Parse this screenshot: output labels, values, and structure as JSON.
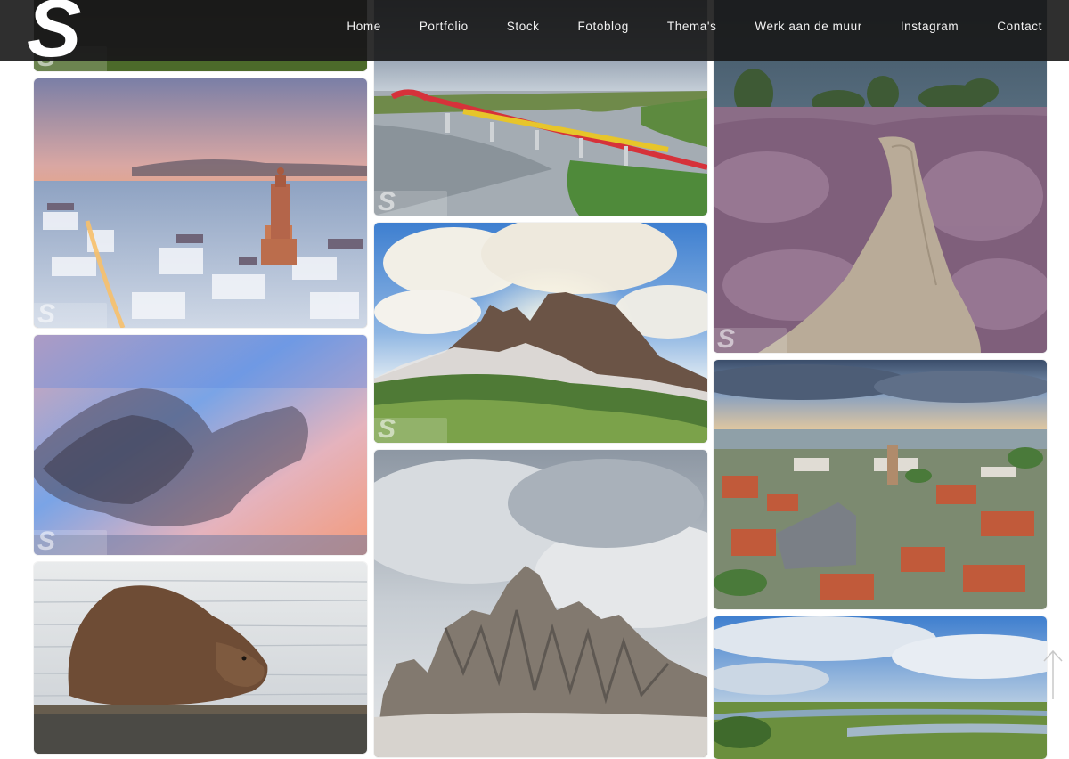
{
  "site": {
    "logo_letter": "S"
  },
  "nav": [
    {
      "label": "Home",
      "key": "home"
    },
    {
      "label": "Portfolio",
      "key": "portfolio"
    },
    {
      "label": "Stock",
      "key": "stock"
    },
    {
      "label": "Fotoblog",
      "key": "fotoblog"
    },
    {
      "label": "Thema's",
      "key": "themas"
    },
    {
      "label": "Werk aan de muur",
      "key": "werk-aan-de-muur"
    },
    {
      "label": "Instagram",
      "key": "instagram"
    },
    {
      "label": "Contact",
      "key": "contact"
    }
  ],
  "gallery": {
    "watermark_letter": "S",
    "photos": [
      {
        "key": "photo-dark-field",
        "subject": "dark landscape"
      },
      {
        "key": "photo-city-sunset-tower",
        "subject": "snowy city with tower at sunset"
      },
      {
        "key": "photo-starling-murmuration",
        "subject": "starling murmuration at sunset"
      },
      {
        "key": "photo-beaver",
        "subject": "beaver in water"
      },
      {
        "key": "photo-red-railway-bridge",
        "subject": "train on red railway bridge over river"
      },
      {
        "key": "photo-dolomites-sunburst",
        "subject": "mountain peak with sunburst"
      },
      {
        "key": "photo-cloudy-mountain",
        "subject": "rocky mountain in clouds"
      },
      {
        "key": "photo-heather-path",
        "subject": "sandy path through heather"
      },
      {
        "key": "photo-aerial-old-town",
        "subject": "aerial view of old town and church"
      },
      {
        "key": "photo-river-landscape",
        "subject": "river landscape under clouds"
      }
    ]
  },
  "colors": {
    "header_bg": "#181818",
    "nav_text": "#f2f2f2",
    "page_bg": "#ffffff"
  },
  "icons": {
    "scroll_top": "arrow-up-icon"
  }
}
